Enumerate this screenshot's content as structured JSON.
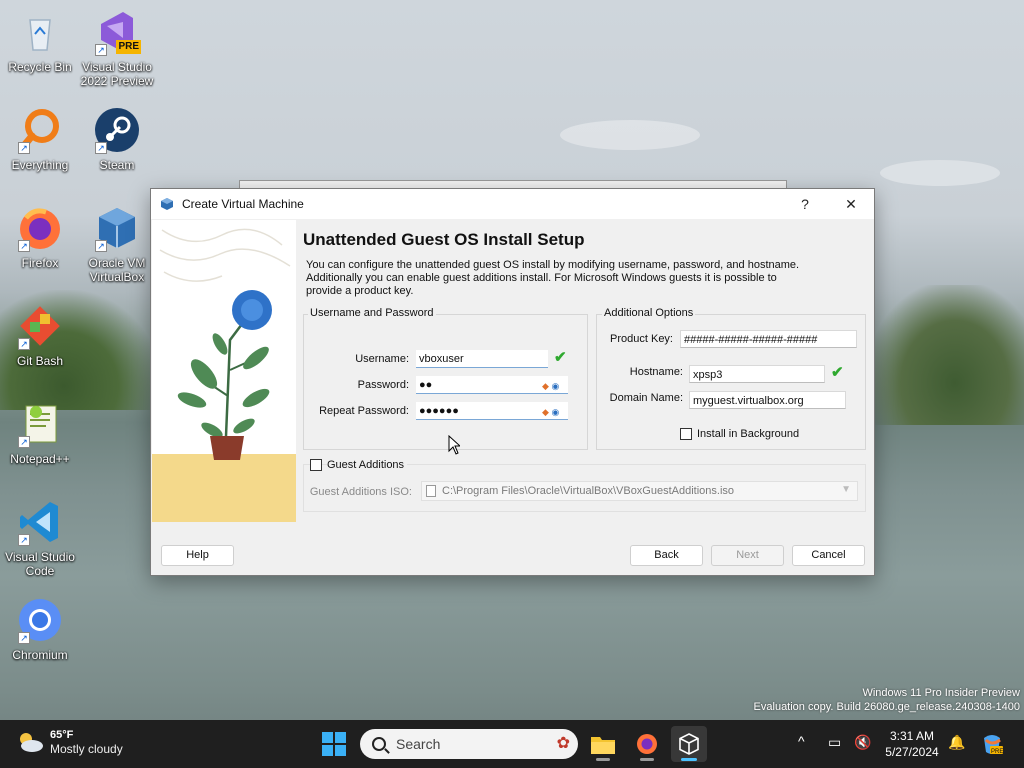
{
  "desktop": {
    "icons": [
      {
        "label": "Recycle Bin"
      },
      {
        "label": "Visual Studio\n2022 Preview",
        "badge": "PRE"
      },
      {
        "label": "Everything"
      },
      {
        "label": "Steam"
      },
      {
        "label": "Firefox"
      },
      {
        "label": "Oracle VM\nVirtualBox"
      },
      {
        "label": "Git Bash"
      },
      {
        "label": "Notepad++"
      },
      {
        "label": "Visual Studio\nCode"
      },
      {
        "label": "Chromium"
      }
    ],
    "watermark": {
      "line1": "Windows 11 Pro Insider Preview",
      "line2": "Evaluation copy. Build 26080.ge_release.240308-1400"
    }
  },
  "dialog": {
    "title": "Create Virtual Machine",
    "help_glyph": "?",
    "close_glyph": "✕",
    "heading": "Unattended Guest OS Install Setup",
    "description": "You can configure the unattended guest OS install by modifying username, password, and hostname. Additionally you can enable guest additions install. For Microsoft Windows guests it is possible to provide a product key.",
    "username_group": {
      "title": "Username and Password",
      "username_label": "Username:",
      "username_value": "vboxuser",
      "password_label": "Password:",
      "password_value": "●●",
      "repeat_label": "Repeat Password:",
      "repeat_value": "●●●●●●"
    },
    "additional_group": {
      "title": "Additional Options",
      "product_key_label": "Product Key:",
      "product_key_value": "#####-#####-#####-#####",
      "hostname_label": "Hostname:",
      "hostname_value": "xpsp3",
      "domain_label": "Domain Name:",
      "domain_value": "myguest.virtualbox.org",
      "install_bg_label": "Install in Background",
      "install_bg_checked": false
    },
    "guest_additions": {
      "label": "Guest Additions",
      "checked": false,
      "iso_label": "Guest Additions ISO:",
      "iso_value": "C:\\Program Files\\Oracle\\VirtualBox\\VBoxGuestAdditions.iso"
    },
    "buttons": {
      "help": "Help",
      "back": "Back",
      "next": "Next",
      "cancel": "Cancel"
    },
    "colors": {
      "valid_check": "#2fa92f",
      "accent": "#7aa7d6"
    }
  },
  "taskbar": {
    "weather_temp": "65°F",
    "weather_condition": "Mostly cloudy",
    "search_placeholder": "Search",
    "apps": [
      "file-explorer",
      "firefox",
      "virtualbox"
    ],
    "active_app": "virtualbox",
    "time": "3:31 AM",
    "date": "5/27/2024",
    "tray_chevron": "^"
  }
}
